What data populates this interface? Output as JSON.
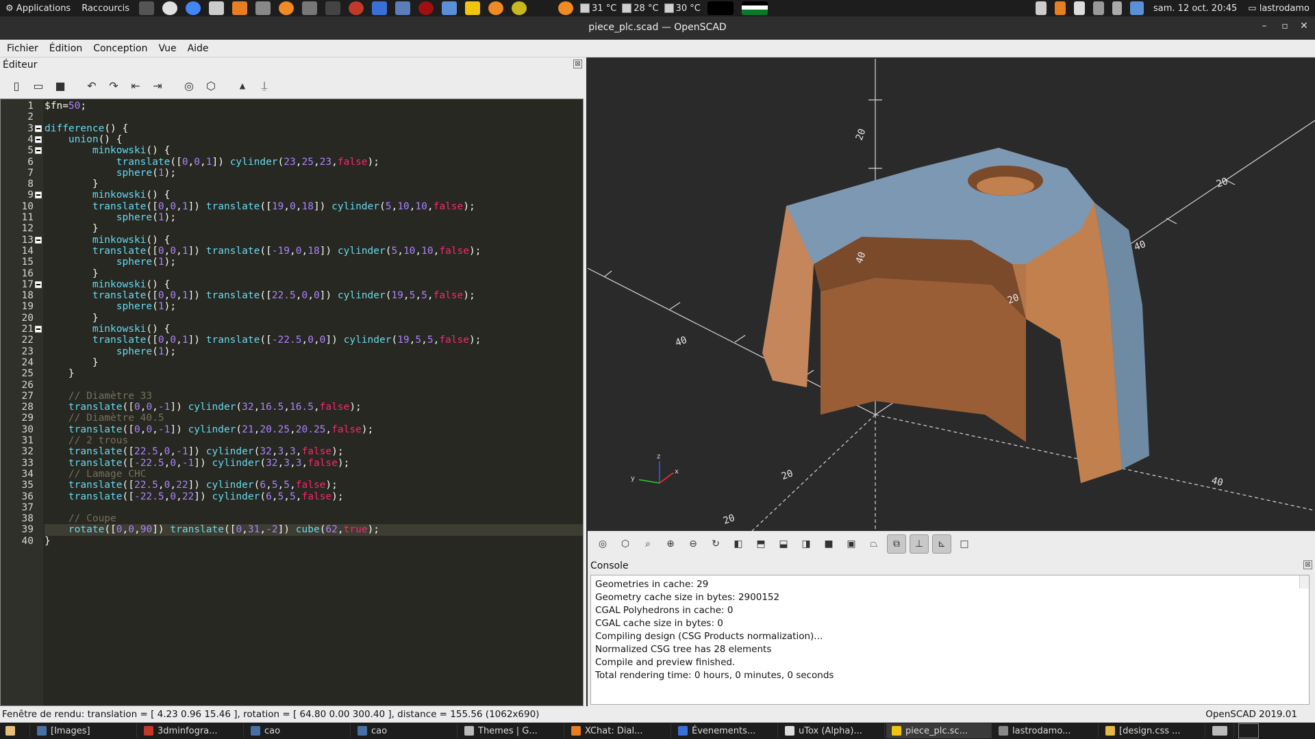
{
  "topbar": {
    "applications": "Applications",
    "shortcuts": "Raccourcis",
    "temps": [
      "31 °C",
      "28 °C",
      "30 °C"
    ],
    "datetime": "sam. 12 oct. 20:45",
    "user": "lastrodamo"
  },
  "window": {
    "title": "piece_plc.scad — OpenSCAD"
  },
  "menu": [
    {
      "label": "Fichier"
    },
    {
      "label": "Édition"
    },
    {
      "label": "Conception"
    },
    {
      "label": "Vue"
    },
    {
      "label": "Aide"
    }
  ],
  "editor": {
    "title": "Éditeur",
    "close": "⊠",
    "lines": [
      "$fn=50;",
      "",
      "difference() {",
      "    union() {",
      "        minkowski() {",
      "            translate([0,0,1]) cylinder(23,25,23,false);",
      "            sphere(1);",
      "        }",
      "        minkowski() {",
      "        translate([0,0,1]) translate([19,0,18]) cylinder(5,10,10,false);",
      "            sphere(1);",
      "        }",
      "        minkowski() {",
      "        translate([0,0,1]) translate([-19,0,18]) cylinder(5,10,10,false);",
      "            sphere(1);",
      "        }",
      "        minkowski() {",
      "        translate([0,0,1]) translate([22.5,0,0]) cylinder(19,5,5,false);",
      "            sphere(1);",
      "        }",
      "        minkowski() {",
      "        translate([0,0,1]) translate([-22.5,0,0]) cylinder(19,5,5,false);",
      "            sphere(1);",
      "        }",
      "    }",
      "",
      "    // Diamètre 33",
      "    translate([0,0,-1]) cylinder(32,16.5,16.5,false);",
      "    // Diamètre 40.5",
      "    translate([0,0,-1]) cylinder(21,20.25,20.25,false);",
      "    // 2 trous",
      "    translate([22.5,0,-1]) cylinder(32,3,3,false);",
      "    translate([-22.5,0,-1]) cylinder(32,3,3,false);",
      "    // Lamage CHC",
      "    translate([22.5,0,22]) cylinder(6,5,5,false);",
      "    translate([-22.5,0,22]) cylinder(6,5,5,false);",
      "",
      "    // Coupe",
      "    rotate([0,0,90]) translate([0,31,-2]) cube(62,true);",
      "}"
    ],
    "fold_lines": [
      3,
      4,
      5,
      9,
      13,
      17,
      21
    ],
    "current_line": 39
  },
  "viewport": {
    "axis_labels": {
      "z": "z",
      "x": "x",
      "y": "y"
    },
    "tick_labels": [
      "40",
      "20",
      "40",
      "20",
      "40",
      "20",
      "20",
      "20",
      "40"
    ]
  },
  "console": {
    "title": "Console",
    "close": "⊠",
    "lines": [
      "Geometries in cache: 29",
      "Geometry cache size in bytes: 2900152",
      "CGAL Polyhedrons in cache: 0",
      "CGAL cache size in bytes: 0",
      "Compiling design (CSG Products normalization)...",
      "Normalized CSG tree has 28 elements",
      "Compile and preview finished.",
      "Total rendering time: 0 hours, 0 minutes, 0 seconds"
    ]
  },
  "status": {
    "left": "Fenêtre de rendu: translation = [ 4.23 0.96 15.46 ], rotation = [ 64.80 0.00 300.40 ], distance = 155.56 (1062x690)",
    "right": "OpenSCAD 2019.01"
  },
  "taskbar": [
    {
      "label": "[Images]",
      "color": "#4a6fa5"
    },
    {
      "label": "3dminfogra...",
      "color": "#c0392b"
    },
    {
      "label": "cao",
      "color": "#4a6fa5"
    },
    {
      "label": "cao",
      "color": "#4a6fa5"
    },
    {
      "label": "Themes | G...",
      "color": "#bbbbbb"
    },
    {
      "label": "XChat: Dial...",
      "color": "#e67e22"
    },
    {
      "label": "Évenements...",
      "color": "#3b6fd8"
    },
    {
      "label": "uTox (Alpha)...",
      "color": "#dddddd"
    },
    {
      "label": "piece_plc.sc...",
      "color": "#f1c40f"
    },
    {
      "label": "lastrodamo...",
      "color": "#888888"
    },
    {
      "label": "[design.css ...",
      "color": "#e6b84a"
    }
  ]
}
